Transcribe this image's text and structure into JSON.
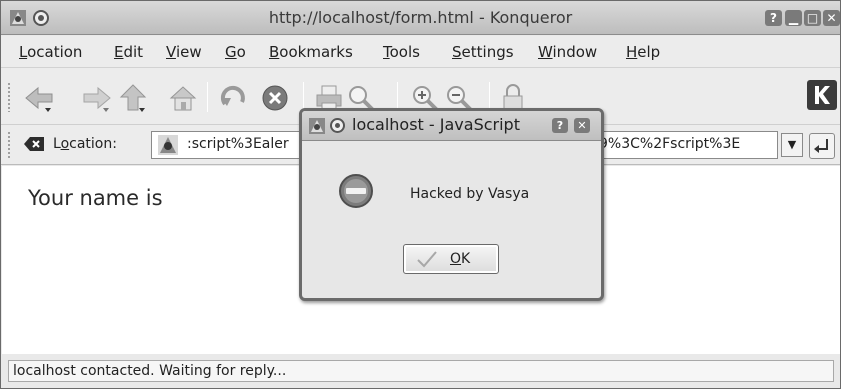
{
  "window": {
    "title": "http://localhost/form.html - Konqueror",
    "controls": {
      "help": "?",
      "minimize": "▁",
      "maximize": "□",
      "close": "✕"
    }
  },
  "menubar": {
    "items": [
      "Location",
      "Edit",
      "View",
      "Go",
      "Bookmarks",
      "Tools",
      "Settings",
      "Window",
      "Help"
    ]
  },
  "toolbar": {
    "icons": [
      "back-icon",
      "forward-icon",
      "up-icon",
      "home-icon",
      "reload-icon",
      "stop-icon",
      "print-icon",
      "find-icon",
      "zoom-in-icon",
      "zoom-out-icon",
      "security-icon",
      "kde-logo-icon"
    ]
  },
  "locationbar": {
    "label_prefix": "L",
    "label_underlined": "o",
    "label_suffix": "cation:",
    "url_visible_left": ":script%3Ealer",
    "url_visible_right": "9%3C%2Fscript%3E",
    "dropdown_glyph": "▼"
  },
  "content": {
    "text": "Your name is"
  },
  "status": {
    "text": "localhost contacted. Waiting for reply..."
  },
  "dialog": {
    "title": "localhost - JavaScript",
    "message": "Hacked by Vasya",
    "ok_label": "OK",
    "controls": {
      "help": "?",
      "close": "✕"
    }
  },
  "colors": {
    "titlebar": "#c9c9c9",
    "window_bg": "#e9e9e9",
    "content_bg": "#ffffff",
    "dialog_border": "#6b6b6b"
  }
}
